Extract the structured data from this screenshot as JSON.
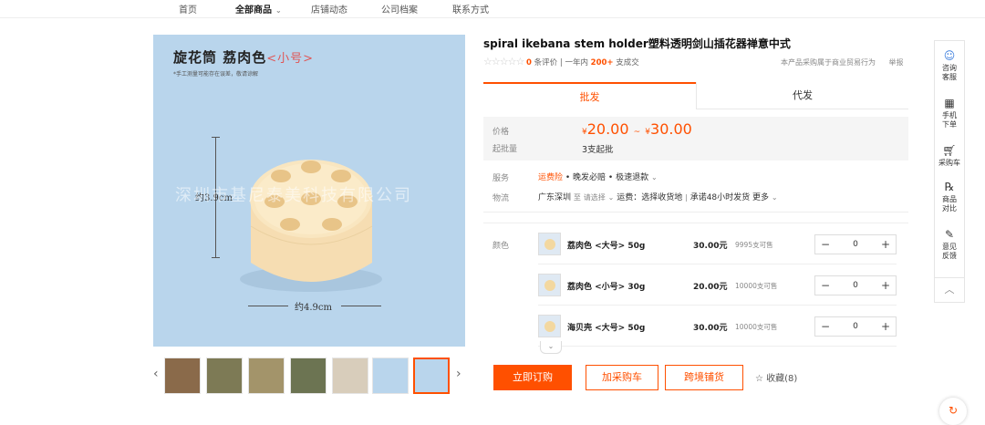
{
  "nav": {
    "items": [
      {
        "label": "首页"
      },
      {
        "label": "全部商品",
        "active": true
      },
      {
        "label": "店铺动态"
      },
      {
        "label": "公司档案"
      },
      {
        "label": "联系方式"
      }
    ]
  },
  "gallery": {
    "main_image": {
      "product_title": "旋花筒 荔肉色",
      "size_tag": "<小号>",
      "note": "*手工测量可能存在误差，敬请谅解",
      "watermark": "深圳市基尼泰美科技有限公司",
      "height_label": "约3.9cm",
      "width_label": "约4.9cm"
    },
    "thumbnail_count": 8,
    "selected_thumbnail": 7
  },
  "product": {
    "title": "spiral ikebana stem holder塑料透明剑山插花器禅意中式",
    "rating_count": "0",
    "rating_label": "条评价",
    "sold_prefix": "一年内",
    "sold_count": "200+",
    "sold_suffix": "支成交",
    "trade_notice": "本产品采购属于商业贸易行为",
    "report_label": "举报"
  },
  "tabs": [
    {
      "label": "批发",
      "active": true
    },
    {
      "label": "代发",
      "active": false
    }
  ],
  "pricing": {
    "price_label": "价格",
    "currency": "¥",
    "price_min": "20.00",
    "price_max": "30.00",
    "separator": "~",
    "moq_label": "起批量",
    "moq_value": "3支起批"
  },
  "service": {
    "label": "服务",
    "highlight": "运费险",
    "items": "• 晚发必赔 • 极速退款"
  },
  "logistics": {
    "label": "物流",
    "origin": "广东深圳",
    "to": "至",
    "select_placeholder": "请选择",
    "freight": "运费：选择收货地",
    "promise": "承诺48小时发货",
    "more": "更多"
  },
  "color": {
    "label": "颜色",
    "skus": [
      {
        "name": "荔肉色 <大号> 50g",
        "price": "30.00元",
        "stock": "9995支可售",
        "qty": "0"
      },
      {
        "name": "荔肉色 <小号> 30g",
        "price": "20.00元",
        "stock": "10000支可售",
        "qty": "0"
      },
      {
        "name": "海贝壳 <大号> 50g",
        "price": "30.00元",
        "stock": "10000支可售",
        "qty": "0"
      }
    ]
  },
  "actions": {
    "buy_now": "立即订购",
    "add_cart": "加采购车",
    "cross_border": "跨境铺货",
    "favorite": "收藏(8)"
  },
  "sidebar": {
    "items": [
      {
        "label": "咨询客服",
        "icon": "headset-icon"
      },
      {
        "label": "手机下单",
        "icon": "qrcode-icon"
      },
      {
        "label": "采购车",
        "icon": "cart-icon"
      },
      {
        "label": "商品对比",
        "icon": "compare-icon"
      },
      {
        "label": "意见反馈",
        "icon": "feedback-icon"
      }
    ]
  },
  "colors": {
    "accent": "#ff5000",
    "image_bg": "#b9d5ec"
  }
}
